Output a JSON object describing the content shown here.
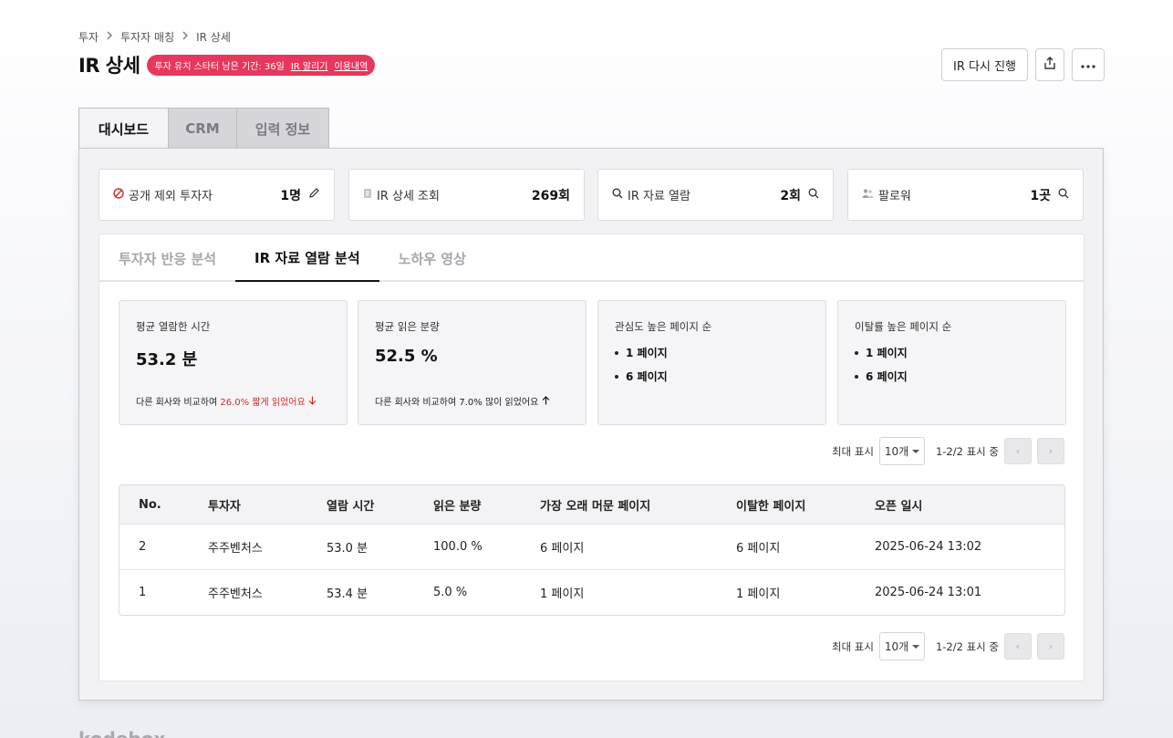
{
  "breadcrumb": [
    "투자",
    "투자자 매칭",
    "IR 상세"
  ],
  "page_title": "IR 상세",
  "notice": {
    "text": "투자 유치 스타터 남은 기간: 36일",
    "link1": "IR 알리기",
    "link2": "이용내역"
  },
  "actions": {
    "retry_label": "IR 다시 진행",
    "share_icon": "share-icon",
    "more_icon": "more-icon"
  },
  "top_tabs": [
    "대시보드",
    "CRM",
    "입력 정보"
  ],
  "stats": [
    {
      "label": "공개 제외 투자자",
      "value": "1명",
      "icon": "block-icon",
      "action_icon": "pencil-icon"
    },
    {
      "label": "IR 상세 조회",
      "value": "269회",
      "icon": "document-icon"
    },
    {
      "label": "IR 자료 열람",
      "value": "2회",
      "icon": "search-icon",
      "action_icon": "search-icon"
    },
    {
      "label": "팔로워",
      "value": "1곳",
      "icon": "users-icon",
      "action_icon": "search-icon"
    }
  ],
  "sub_tabs": [
    "투자자 반응 분석",
    "IR 자료 열람 분석",
    "노하우 영상"
  ],
  "metrics": {
    "avg_time": {
      "label": "평균 열람한 시간",
      "value": "53.2 분",
      "cmp_prefix": "다른 회사와 비교하여",
      "cmp_value": "26.0% 짧게 읽었어요",
      "trend": "down"
    },
    "avg_amount": {
      "label": "평균 읽은 분량",
      "value": "52.5 %",
      "cmp_prefix": "다른 회사와 비교하여",
      "cmp_value": "7.0% 많이 읽었어요",
      "trend": "up"
    },
    "interest": {
      "label": "관심도 높은 페이지 순",
      "items": [
        "1 페이지",
        "6 페이지"
      ]
    },
    "exit": {
      "label": "이탈률 높은 페이지 순",
      "items": [
        "1 페이지",
        "6 페이지"
      ]
    }
  },
  "pager": {
    "max_label": "최대 표시",
    "per_page": "10개",
    "range": "1-2/2 표시 중"
  },
  "table": {
    "headers": [
      "No.",
      "투자자",
      "열람 시간",
      "읽은 분량",
      "가장 오래 머문 페이지",
      "이탈한 페이지",
      "오픈 일시"
    ],
    "rows": [
      [
        "2",
        "주주벤처스",
        "53.0 분",
        "100.0 %",
        "6 페이지",
        "6 페이지",
        "2025-06-24 13:02"
      ],
      [
        "1",
        "주주벤처스",
        "53.4 분",
        "5.0 %",
        "1 페이지",
        "1 페이지",
        "2025-06-24 13:01"
      ]
    ]
  },
  "footer_logo": "kodebox",
  "colors": {
    "accent": "#e8375c",
    "negative": "#d12b2b"
  }
}
